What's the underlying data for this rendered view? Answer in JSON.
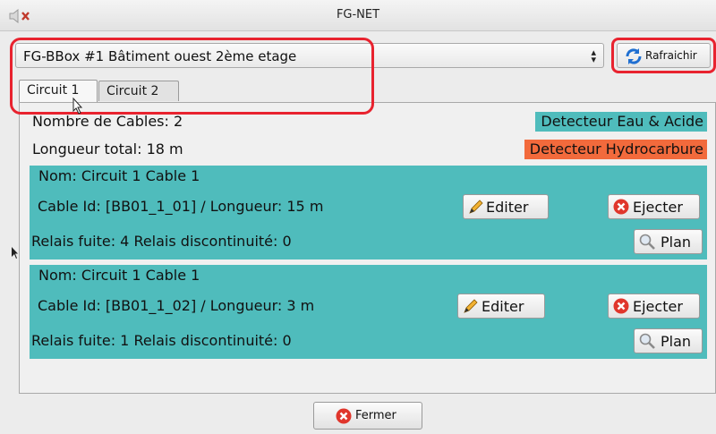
{
  "window": {
    "title": "FG-NET"
  },
  "selector": {
    "value": "FG-BBox #1 Bâtiment ouest 2ème etage"
  },
  "refresh_button": {
    "label": "Rafraichir"
  },
  "tabs": [
    {
      "label": "Circuit 1",
      "active": true
    },
    {
      "label": "Circuit 2",
      "active": false
    }
  ],
  "summary": {
    "cable_count": "Nombre de Cables: 2",
    "total_length": "Longueur total: 18 m"
  },
  "legend": {
    "water": {
      "label": "Detecteur Eau & Acide",
      "color": "#4fbcbc"
    },
    "hydrocarbon": {
      "label": "Detecteur Hydrocarbure",
      "color": "#f26a3c"
    }
  },
  "cables": [
    {
      "name": "Nom: Circuit 1 Cable 1",
      "id_length": "Cable Id: [BB01_1_01] / Longueur: 15 m",
      "relays": "Relais fuite: 4  Relais discontinuité: 0",
      "edit_label": "Editer",
      "eject_label": "Ejecter",
      "plan_label": "Plan"
    },
    {
      "name": "Nom: Circuit 1 Cable 1",
      "id_length": "Cable Id: [BB01_1_02] / Longueur: 3 m",
      "relays": "Relais fuite: 1  Relais discontinuité: 0",
      "edit_label": "Editer",
      "eject_label": "Ejecter",
      "plan_label": "Plan"
    }
  ],
  "footer": {
    "close_label": "Fermer"
  },
  "icons": {
    "speaker": "speaker-muted-icon",
    "refresh": "refresh-icon",
    "edit": "pencil-icon",
    "eject": "red-x-circle-icon",
    "plan": "magnifier-icon",
    "close": "red-x-circle-icon"
  },
  "colors": {
    "highlight": "#e8232f"
  }
}
